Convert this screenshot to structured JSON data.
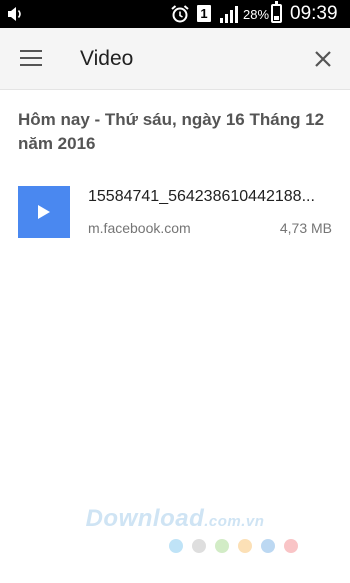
{
  "status_bar": {
    "battery_percent": "28%",
    "battery_level": 0.28,
    "sim_slot": "1",
    "time": "09:39"
  },
  "app_bar": {
    "title": "Video",
    "menu_icon": "hamburger-menu-icon",
    "close_icon": "close-icon"
  },
  "downloads": {
    "date_header": "Hôm nay - Thứ sáu, ngày 16 Tháng 12 năm 2016",
    "items": [
      {
        "file_name": "15584741_564238610442188...",
        "source": "m.facebook.com",
        "size": "4,73 MB",
        "icon": "play-icon",
        "thumb_color": "#4a88f0"
      }
    ]
  },
  "watermark": {
    "brand": "Download",
    "tld": ".com.vn",
    "dot_colors": [
      "#bfe3f7",
      "#dedede",
      "#d2ecc6",
      "#fce0b6",
      "#bcd8f2",
      "#f9c4c6"
    ]
  }
}
